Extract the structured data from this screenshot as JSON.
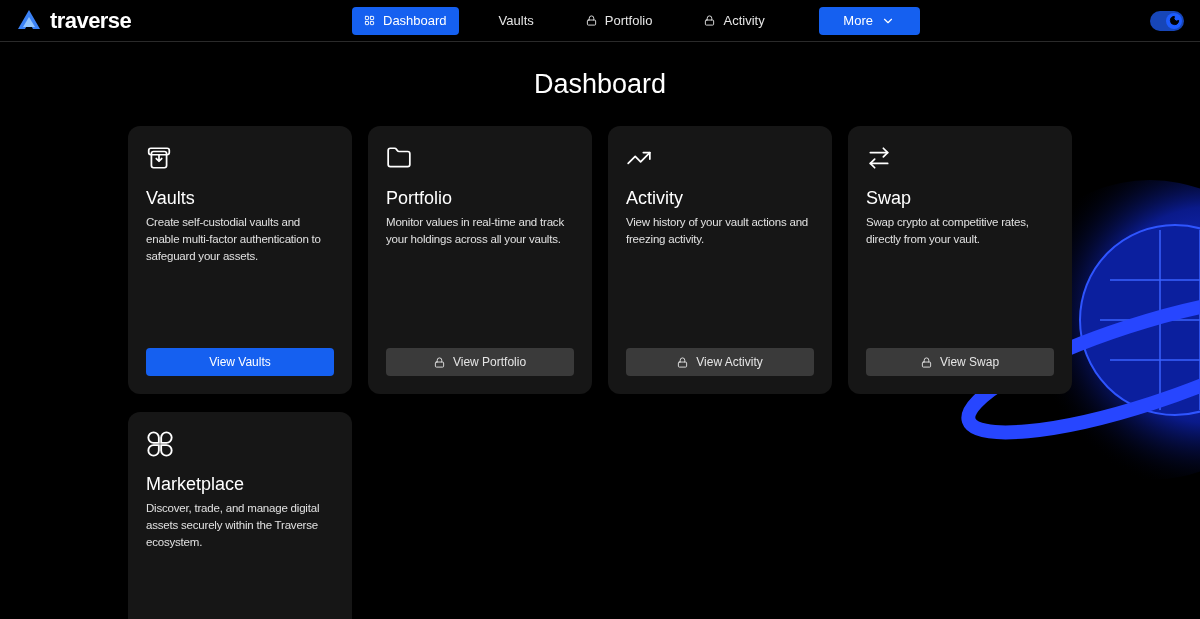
{
  "brand": {
    "name": "traverse"
  },
  "nav": [
    {
      "label": "Dashboard",
      "selected": true,
      "locked": false
    },
    {
      "label": "Vaults",
      "selected": false,
      "locked": false
    },
    {
      "label": "Portfolio",
      "selected": false,
      "locked": true
    },
    {
      "label": "Activity",
      "selected": false,
      "locked": true
    }
  ],
  "more_button": {
    "label": "More"
  },
  "theme_toggle": {
    "on": true
  },
  "page_title": "Dashboard",
  "cards": [
    {
      "title": "Vaults",
      "description": "Create self-custodial vaults and enable multi-factor authentication to safeguard your assets.",
      "button": {
        "label": "View Vaults",
        "locked": false
      }
    },
    {
      "title": "Portfolio",
      "description": "Monitor values in real-time and track your holdings across all your vaults.",
      "button": {
        "label": "View Portfolio",
        "locked": true
      }
    },
    {
      "title": "Activity",
      "description": "View history of your vault actions and freezing activity.",
      "button": {
        "label": "View Activity",
        "locked": true
      }
    },
    {
      "title": "Swap",
      "description": "Swap crypto at competitive rates, directly from your vault.",
      "button": {
        "label": "View Swap",
        "locked": true
      }
    },
    {
      "title": "Marketplace",
      "description": "Discover, trade, and manage digital assets securely within the Traverse ecosystem."
    }
  ]
}
